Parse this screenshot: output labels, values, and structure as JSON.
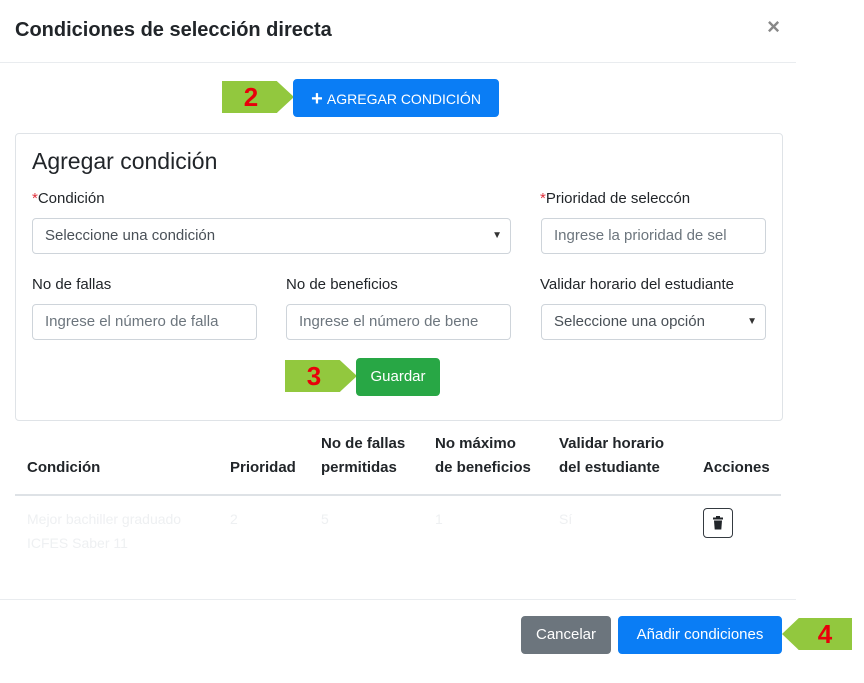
{
  "modal": {
    "title": "Condiciones de selección directa",
    "close_symbol": "×"
  },
  "callouts": {
    "step2": "2",
    "step3": "3",
    "step4": "4"
  },
  "add_button": {
    "icon": "plus-icon",
    "icon_glyph": "+",
    "label": "AGREGAR CONDICIÓN"
  },
  "form": {
    "title": "Agregar condición",
    "required_mark": "*",
    "condicion": {
      "label": "Condición",
      "value": "Seleccione una condición"
    },
    "prioridad": {
      "label": "Prioridad de seleccón",
      "placeholder": "Ingrese la prioridad de sel"
    },
    "fallas": {
      "label": "No de fallas",
      "placeholder": "Ingrese el número de falla"
    },
    "beneficios": {
      "label": "No de beneficios",
      "placeholder": "Ingrese el número de bene"
    },
    "horario": {
      "label": "Validar horario del estudiante",
      "value": "Seleccione una opción"
    },
    "save_label": "Guardar"
  },
  "table": {
    "headers": {
      "condicion": "Condición",
      "prioridad": "Prioridad",
      "fallas_line1": "No de fallas",
      "fallas_line2": "permitidas",
      "beneficios_line1": "No máximo",
      "beneficios_line2": "de beneficios",
      "horario_line1": "Validar horario",
      "horario_line2": "del estudiante",
      "acciones": "Acciones"
    },
    "rows": [
      {
        "condicion_line1": "Mejor bachiller graduado",
        "condicion_line2": "ICFES Saber 11",
        "prioridad": "2",
        "fallas": "5",
        "beneficios": "1",
        "horario": "Sí",
        "action_icon": "trash-icon"
      }
    ]
  },
  "footer": {
    "cancel_label": "Cancelar",
    "submit_label": "Añadir condiciones"
  },
  "colors": {
    "primary": "#0a7df5",
    "success": "#28a745",
    "secondary": "#6c757d",
    "callout_bg": "#92c83e",
    "callout_text": "#e8000b"
  }
}
